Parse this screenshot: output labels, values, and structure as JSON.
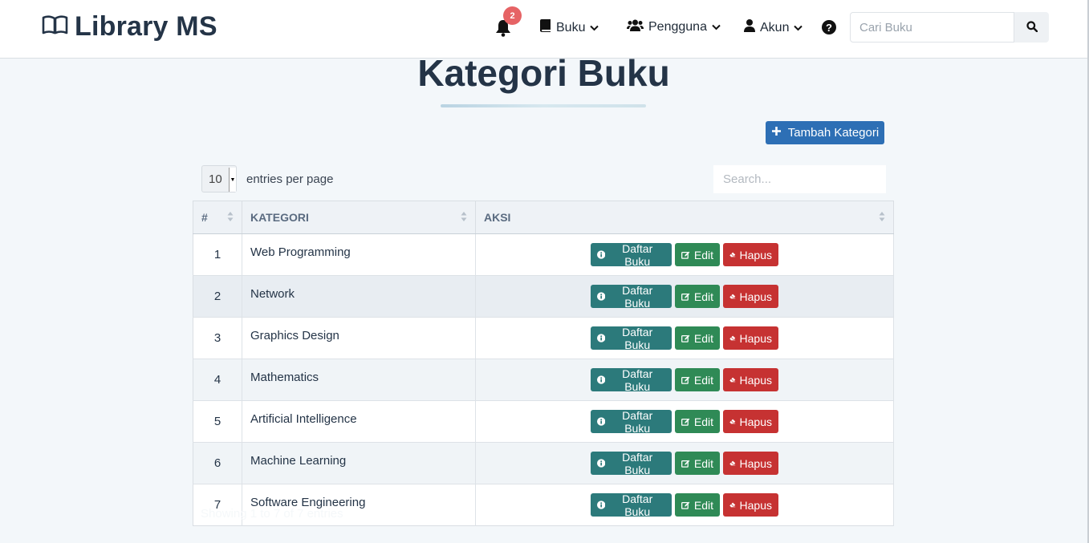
{
  "navbar": {
    "brand": "Library MS",
    "notification_count": "2",
    "menu": [
      {
        "label": "Buku"
      },
      {
        "label": "Pengguna"
      },
      {
        "label": "Akun"
      }
    ],
    "help_icon": "question-circle-icon",
    "search_placeholder": "Cari Buku"
  },
  "page": {
    "title": "Kategori Buku",
    "add_button": "Tambah Kategori"
  },
  "datatable": {
    "per_page_value": "10",
    "per_page_label": "entries per page",
    "search_placeholder": "Search...",
    "headers": [
      "#",
      "KATEGORI",
      "AKSI"
    ],
    "rows": [
      {
        "no": "1",
        "kategori": "Web Programming"
      },
      {
        "no": "2",
        "kategori": "Network"
      },
      {
        "no": "3",
        "kategori": "Graphics Design"
      },
      {
        "no": "4",
        "kategori": "Mathematics"
      },
      {
        "no": "5",
        "kategori": "Artificial Intelligence"
      },
      {
        "no": "6",
        "kategori": "Machine Learning"
      },
      {
        "no": "7",
        "kategori": "Software Engineering"
      }
    ],
    "action_labels": {
      "info": "Daftar Buku",
      "edit": "Edit",
      "delete": "Hapus"
    },
    "footer": "Showing 1 to 7 of 7 entries"
  },
  "colors": {
    "primary": "#2d6fb5",
    "info": "#2c7a7b",
    "edit": "#2f8a56",
    "delete": "#c63232",
    "badge": "#e66365"
  }
}
